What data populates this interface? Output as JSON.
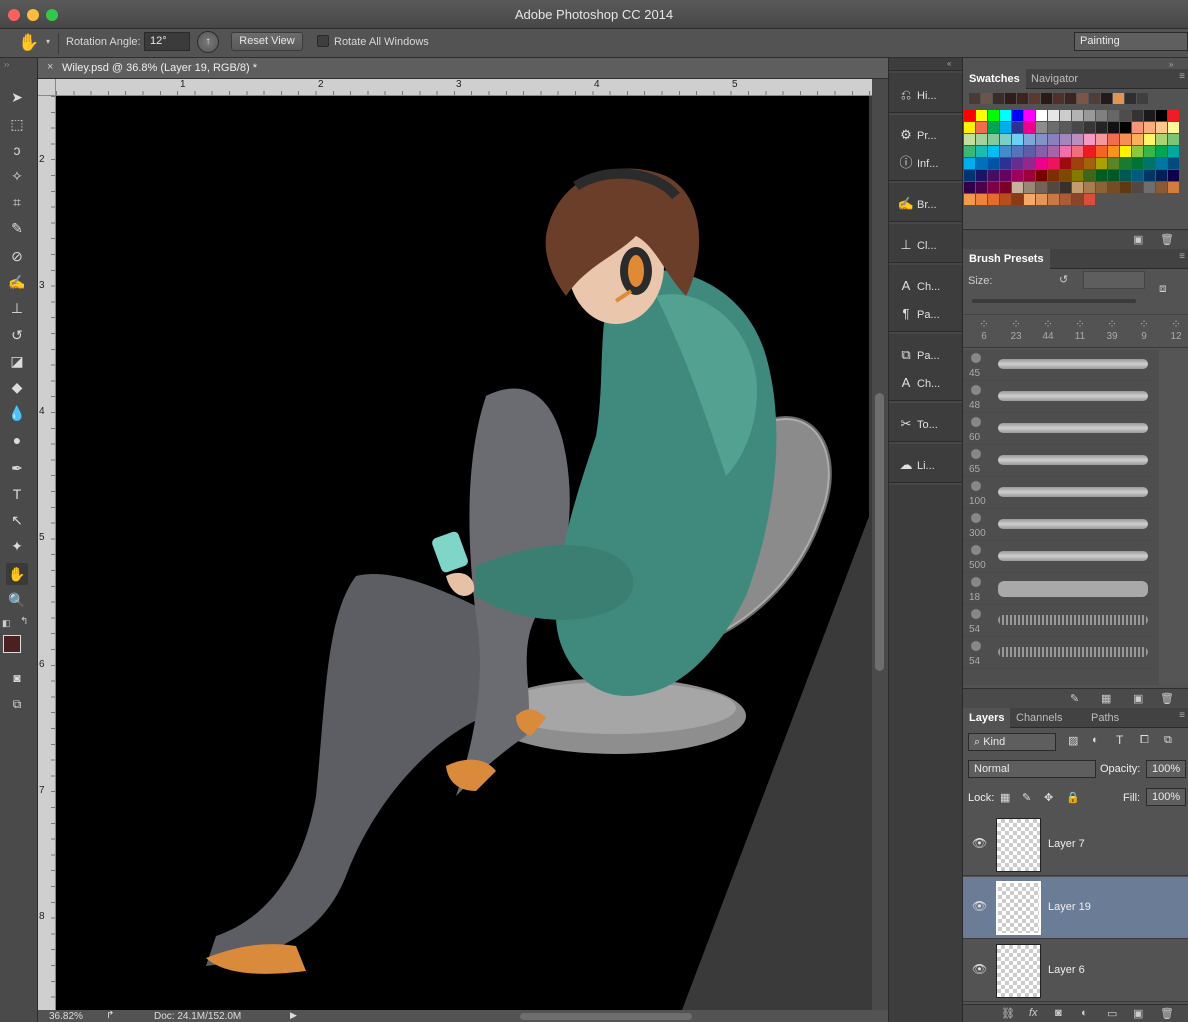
{
  "app": {
    "title": "Adobe Photoshop CC 2014"
  },
  "options": {
    "rotation_label": "Rotation Angle:",
    "rotation_value": "12°",
    "reset_view": "Reset View",
    "rotate_all": "Rotate All Windows",
    "workspace": "Painting"
  },
  "document": {
    "tab": "Wiley.psd @ 36.8% (Layer 19, RGB/8) *",
    "close": "×",
    "ruler_top": [
      "1",
      "2",
      "3",
      "4",
      "5"
    ],
    "ruler_left": [
      "2",
      "3",
      "4",
      "5",
      "6",
      "7",
      "8"
    ]
  },
  "status": {
    "zoom": "36.82%",
    "doc": "Doc: 24.1M/152.0M"
  },
  "dock": {
    "items": [
      "Hi...",
      "Pr...",
      "Inf...",
      "Br...",
      "Cl...",
      "Ch...",
      "Pa...",
      "Pa...",
      "Ch...",
      "To...",
      "Li..."
    ]
  },
  "swatches": {
    "tabs": [
      "Swatches",
      "Navigator"
    ],
    "recent": [
      "#4a3a36",
      "#6b544c",
      "#3c2c28",
      "#2e1d1a",
      "#40231f",
      "#5a3a2e",
      "#2b1916",
      "#51302a",
      "#3a2521",
      "#7b5647",
      "#4d3e3a",
      "#25191a",
      "#e39450",
      "#2f2f2f",
      "#3f3f3f"
    ],
    "colors": [
      "#ff0000",
      "#ffff00",
      "#00ff00",
      "#00ffff",
      "#0000ff",
      "#ff00ff",
      "#ffffff",
      "#e6e6e6",
      "#cccccc",
      "#b3b3b3",
      "#999999",
      "#808080",
      "#666666",
      "#4d4d4d",
      "#333333",
      "#1a1a1a",
      "#000000",
      "#ee1c24",
      "#fff200",
      "#f26c4f",
      "#00a651",
      "#00aeef",
      "#2e3192",
      "#ec008c",
      "#8c8c8c",
      "#6d6d6d",
      "#5a5a5a",
      "#484848",
      "#363636",
      "#242424",
      "#121212",
      "#000000",
      "#f69679",
      "#f9ad81",
      "#fdc68a",
      "#fff799",
      "#c4df9b",
      "#a3d39c",
      "#82ca9d",
      "#7bcdc8",
      "#6ecff6",
      "#7ea7d8",
      "#8393ca",
      "#8781bd",
      "#a187be",
      "#bc8dbf",
      "#f49ac1",
      "#f5989d",
      "#f26c4f",
      "#f68e56",
      "#fbaf5d",
      "#fff568",
      "#acd373",
      "#7cc576",
      "#3bb878",
      "#1abbb4",
      "#00bff3",
      "#438ccb",
      "#5574b9",
      "#605ca8",
      "#855fa8",
      "#a864a8",
      "#f06eaa",
      "#f26d7d",
      "#ed1c24",
      "#f26522",
      "#f7941d",
      "#fff200",
      "#8dc63f",
      "#39b54a",
      "#00a651",
      "#00a99d",
      "#00aeef",
      "#0072bc",
      "#0054a6",
      "#2e3192",
      "#662d91",
      "#92278f",
      "#ec008c",
      "#ed145b",
      "#9e0b0f",
      "#a0410d",
      "#a36209",
      "#aba000",
      "#598527",
      "#1a7b30",
      "#007236",
      "#00746b",
      "#0076a3",
      "#004b80",
      "#003471",
      "#1b1464",
      "#440e62",
      "#630460",
      "#9e005d",
      "#9e0039",
      "#790000",
      "#7b2e00",
      "#7d4900",
      "#827b00",
      "#406618",
      "#005e20",
      "#005826",
      "#005952",
      "#005b7f",
      "#003663",
      "#002157",
      "#0d004c",
      "#32004b",
      "#4b0049",
      "#7b0046",
      "#7a0026",
      "#c7b299",
      "#998675",
      "#736357",
      "#534741",
      "#37302d",
      "#c69c6d",
      "#a67c52",
      "#8c6239",
      "#754c24",
      "#603913",
      "#534741",
      "#6e6e6e",
      "#8a5a34",
      "#d27d3c",
      "#f29a4b",
      "#f0823a",
      "#e36c2a",
      "#b84d1c",
      "#8b3a17",
      "#f7a866",
      "#e4955a",
      "#c97846",
      "#aa5c35",
      "#8a4429",
      "#d94e3a"
    ]
  },
  "brushes": {
    "title": "Brush Presets",
    "size_label": "Size:",
    "top_sizes": [
      "6",
      "23",
      "44",
      "11",
      "39",
      "9",
      "12"
    ],
    "list": [
      "45",
      "48",
      "60",
      "65",
      "100",
      "300",
      "500",
      "18",
      "54",
      "54"
    ]
  },
  "layers": {
    "tabs": [
      "Layers",
      "Channels",
      "Paths"
    ],
    "kind": "Kind",
    "blend": "Normal",
    "opacity_label": "Opacity:",
    "opacity": "100%",
    "lock_label": "Lock:",
    "fill_label": "Fill:",
    "fill": "100%",
    "items": [
      "Layer 7",
      "Layer 19",
      "Layer 6"
    ],
    "selected_color": "#6b7d96"
  }
}
